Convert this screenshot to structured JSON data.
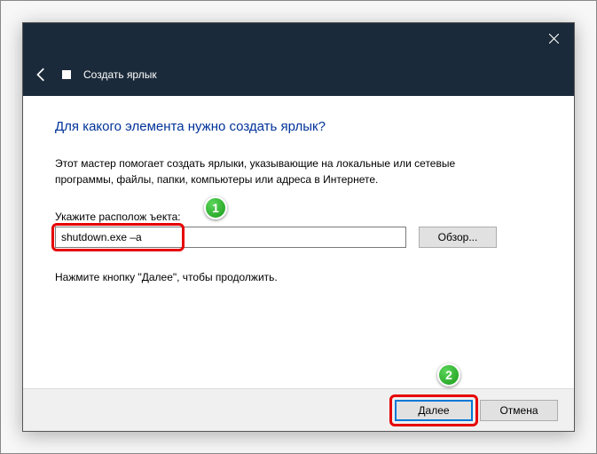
{
  "header": {
    "title": "Создать ярлык"
  },
  "content": {
    "heading": "Для какого элемента нужно создать ярлык?",
    "description": "Этот мастер помогает создать ярлыки, указывающие на локальные или сетевые программы, файлы, папки, компьютеры или адреса в Интернете.",
    "field_label": "Укажите располож            ъекта:",
    "input_value": "shutdown.exe –a",
    "browse_label": "Обзор...",
    "hint": "Нажмите кнопку \"Далее\", чтобы продолжить."
  },
  "footer": {
    "next": "Далее",
    "cancel": "Отмена"
  },
  "annotations": {
    "badge1": "1",
    "badge2": "2"
  }
}
